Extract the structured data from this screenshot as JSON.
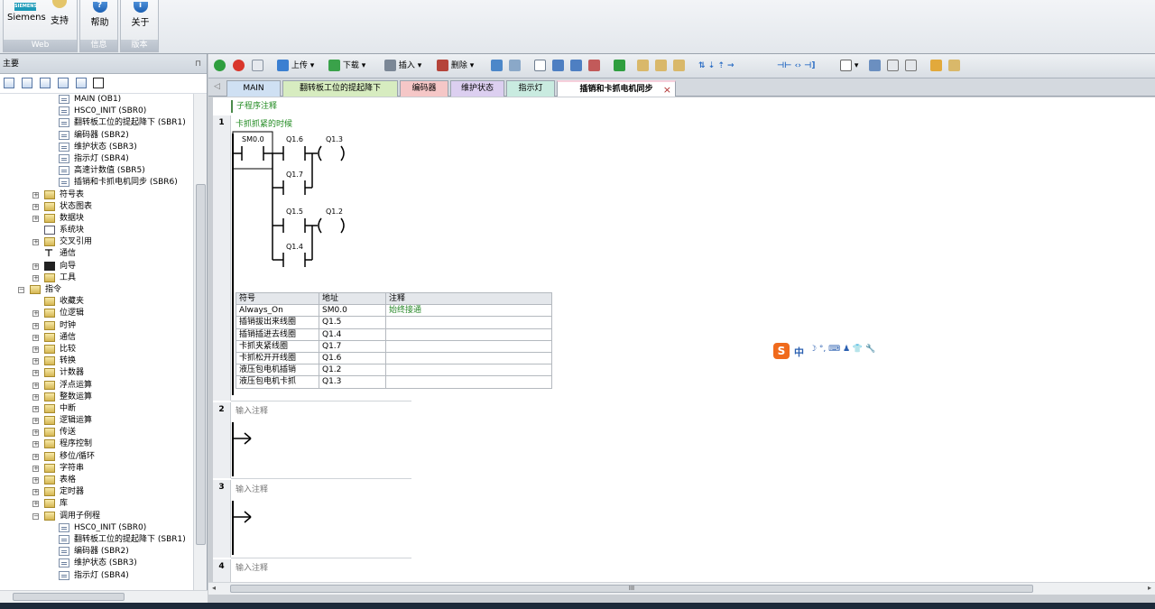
{
  "ribbon": {
    "web_group": {
      "label": "Web",
      "siemens_logo": "SIEMENS",
      "siemens_label": "Siemens",
      "support_label": "支持"
    },
    "info_group": {
      "label": "信息",
      "help_label": "帮助"
    },
    "version_group": {
      "label": "版本",
      "about_label": "关于"
    }
  },
  "left_pane": {
    "title": "主要",
    "pin": "⊓",
    "tree": [
      {
        "label": "MAIN (OB1)",
        "indent": 3,
        "icon": "doc"
      },
      {
        "label": "HSC0_INIT (SBR0)",
        "indent": 3,
        "icon": "doc"
      },
      {
        "label": "翻转板工位的提起降下 (SBR1)",
        "indent": 3,
        "icon": "doc"
      },
      {
        "label": "编码器 (SBR2)",
        "indent": 3,
        "icon": "doc"
      },
      {
        "label": "维护状态 (SBR3)",
        "indent": 3,
        "icon": "doc"
      },
      {
        "label": "指示灯 (SBR4)",
        "indent": 3,
        "icon": "doc"
      },
      {
        "label": "高速计数值 (SBR5)",
        "indent": 3,
        "icon": "doc"
      },
      {
        "label": "插销和卡抓电机同步 (SBR6)",
        "indent": 3,
        "icon": "doc"
      },
      {
        "label": "符号表",
        "indent": 2,
        "icon": "folder",
        "expander": "+"
      },
      {
        "label": "状态图表",
        "indent": 2,
        "icon": "folder",
        "expander": "+"
      },
      {
        "label": "数据块",
        "indent": 2,
        "icon": "folder",
        "expander": "+"
      },
      {
        "label": "系统块",
        "indent": 2,
        "icon": "blk"
      },
      {
        "label": "交叉引用",
        "indent": 2,
        "icon": "folder",
        "expander": "+"
      },
      {
        "label": "通信",
        "indent": 2,
        "icon": "comm"
      },
      {
        "label": "向导",
        "indent": 2,
        "icon": "flag",
        "expander": "+"
      },
      {
        "label": "工具",
        "indent": 2,
        "icon": "folder",
        "expander": "+"
      },
      {
        "label": "指令",
        "indent": 1,
        "icon": "folder",
        "expander": "−"
      },
      {
        "label": "收藏夹",
        "indent": 2,
        "icon": "folder"
      },
      {
        "label": "位逻辑",
        "indent": 2,
        "icon": "folder",
        "expander": "+"
      },
      {
        "label": "时钟",
        "indent": 2,
        "icon": "folder",
        "expander": "+"
      },
      {
        "label": "通信",
        "indent": 2,
        "icon": "folder",
        "expander": "+"
      },
      {
        "label": "比较",
        "indent": 2,
        "icon": "folder",
        "expander": "+"
      },
      {
        "label": "转换",
        "indent": 2,
        "icon": "folder",
        "expander": "+"
      },
      {
        "label": "计数器",
        "indent": 2,
        "icon": "folder",
        "expander": "+"
      },
      {
        "label": "浮点运算",
        "indent": 2,
        "icon": "folder",
        "expander": "+"
      },
      {
        "label": "整数运算",
        "indent": 2,
        "icon": "folder",
        "expander": "+"
      },
      {
        "label": "中断",
        "indent": 2,
        "icon": "folder",
        "expander": "+"
      },
      {
        "label": "逻辑运算",
        "indent": 2,
        "icon": "folder",
        "expander": "+"
      },
      {
        "label": "传送",
        "indent": 2,
        "icon": "folder",
        "expander": "+"
      },
      {
        "label": "程序控制",
        "indent": 2,
        "icon": "folder",
        "expander": "+"
      },
      {
        "label": "移位/循环",
        "indent": 2,
        "icon": "folder",
        "expander": "+"
      },
      {
        "label": "字符串",
        "indent": 2,
        "icon": "folder",
        "expander": "+"
      },
      {
        "label": "表格",
        "indent": 2,
        "icon": "folder",
        "expander": "+"
      },
      {
        "label": "定时器",
        "indent": 2,
        "icon": "folder",
        "expander": "+"
      },
      {
        "label": "库",
        "indent": 2,
        "icon": "folder",
        "expander": "+"
      },
      {
        "label": "调用子例程",
        "indent": 2,
        "icon": "folder",
        "expander": "−"
      },
      {
        "label": "HSC0_INIT (SBR0)",
        "indent": 3,
        "icon": "doc"
      },
      {
        "label": "翻转板工位的提起降下 (SBR1)",
        "indent": 3,
        "icon": "doc"
      },
      {
        "label": "编码器 (SBR2)",
        "indent": 3,
        "icon": "doc"
      },
      {
        "label": "维护状态 (SBR3)",
        "indent": 3,
        "icon": "doc"
      },
      {
        "label": "指示灯 (SBR4)",
        "indent": 3,
        "icon": "doc"
      }
    ]
  },
  "toolbar": {
    "upload_label": "上传",
    "download_label": "下载",
    "insert_label": "插入",
    "delete_label": "删除"
  },
  "tabs": [
    {
      "label": "MAIN",
      "color": "#cfe0f3"
    },
    {
      "label": "翻转板工位的提起降下",
      "color": "#d7ecc0"
    },
    {
      "label": "编码器",
      "color": "#f5c7c7"
    },
    {
      "label": "维护状态",
      "color": "#dccff0"
    },
    {
      "label": "指示灯",
      "color": "#c9ebe0"
    },
    {
      "label": "插销和卡抓电机同步",
      "color": "#f7d0dc",
      "active": true
    }
  ],
  "tab_close": "×",
  "editor": {
    "subroutine_comment": "子程序注释",
    "networks": [
      {
        "number": "1",
        "comment": "卡抓抓紧的时候"
      },
      {
        "number": "2",
        "comment": "输入注释"
      },
      {
        "number": "3",
        "comment": "输入注释"
      },
      {
        "number": "4",
        "comment": "输入注释"
      }
    ],
    "ladder": {
      "contacts": [
        "SM0.0",
        "Q1.6",
        "Q1.7",
        "Q1.5",
        "Q1.4"
      ],
      "coils": [
        "Q1.3",
        "Q1.2"
      ]
    },
    "symbol_table": {
      "headers": [
        "符号",
        "地址",
        "注释"
      ],
      "rows": [
        [
          "Always_On",
          "SM0.0",
          "始终接通"
        ],
        [
          "插销拔出来线圈",
          "Q1.5",
          ""
        ],
        [
          "插销插进去线圈",
          "Q1.4",
          ""
        ],
        [
          "卡抓夹紧线圈",
          "Q1.7",
          ""
        ],
        [
          "卡抓松开开线圈",
          "Q1.6",
          ""
        ],
        [
          "液压包电机插销",
          "Q1.2",
          ""
        ],
        [
          "液压包电机卡抓",
          "Q1.3",
          ""
        ]
      ]
    }
  },
  "ime": {
    "logo": "S",
    "mode": "中",
    "glyphs": "☽ °, ⌨ ♟ 👕 🔧"
  },
  "scroll_grip": "III"
}
